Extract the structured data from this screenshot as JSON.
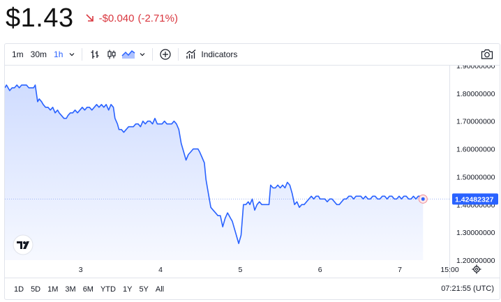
{
  "header": {
    "price": "$1.43",
    "change_amount": "-$0.040",
    "change_percent": "(-2.71%)"
  },
  "colors": {
    "down": "#d9363e",
    "line": "#2962ff",
    "accent": "#2962ff"
  },
  "toolbar": {
    "intervals": [
      "1m",
      "30m",
      "1h"
    ],
    "active_interval": "1h",
    "indicators_label": "Indicators",
    "icons": [
      "chevron-down-icon",
      "bar-chart-icon",
      "candlestick-icon",
      "area-chart-icon",
      "chevron-down-icon",
      "compare-plus-icon",
      "indicators-icon",
      "camera-icon"
    ]
  },
  "ranges": [
    "1D",
    "5D",
    "1M",
    "3M",
    "6M",
    "YTD",
    "1Y",
    "5Y",
    "All"
  ],
  "clock": "07:21:55 (UTC)",
  "chart_data": {
    "type": "area",
    "title": "",
    "xlabel": "",
    "ylabel": "",
    "ylim": [
      1.2,
      1.9
    ],
    "xlim": [
      2.05,
      7.62
    ],
    "y_ticks": [
      "1.20000000",
      "1.30000000",
      "1.40000000",
      "1.50000000",
      "1.60000000",
      "1.70000000",
      "1.80000000",
      "1.90000000"
    ],
    "y_tick_values": [
      1.2,
      1.3,
      1.4,
      1.5,
      1.6,
      1.7,
      1.8,
      1.9
    ],
    "x_ticks": [
      "3",
      "4",
      "5",
      "6",
      "7",
      "15:00"
    ],
    "x_tick_values": [
      3,
      4,
      5,
      6,
      7,
      7.625
    ],
    "last_price_label": "1.42482327",
    "last_price": 1.42482327,
    "grid": false,
    "legend": "none",
    "x": [
      2.05,
      2.07,
      2.09,
      2.11,
      2.14,
      2.17,
      2.2,
      2.23,
      2.26,
      2.29,
      2.32,
      2.35,
      2.38,
      2.41,
      2.43,
      2.46,
      2.48,
      2.51,
      2.53,
      2.56,
      2.59,
      2.62,
      2.65,
      2.68,
      2.71,
      2.73,
      2.76,
      2.79,
      2.82,
      2.84,
      2.87,
      2.9,
      2.93,
      2.96,
      2.99,
      3.02,
      3.05,
      3.08,
      3.11,
      3.14,
      3.17,
      3.2,
      3.23,
      3.26,
      3.29,
      3.32,
      3.35,
      3.38,
      3.41,
      3.43,
      3.46,
      3.48,
      3.51,
      3.54,
      3.57,
      3.6,
      3.63,
      3.66,
      3.69,
      3.72,
      3.75,
      3.78,
      3.81,
      3.84,
      3.87,
      3.9,
      3.93,
      3.96,
      3.99,
      4.02,
      4.05,
      4.08,
      4.11,
      4.14,
      4.17,
      4.2,
      4.23,
      4.26,
      4.29,
      4.32,
      4.35,
      4.38,
      4.41,
      4.44,
      4.47,
      4.49,
      4.52,
      4.55,
      4.57,
      4.6,
      4.63,
      4.66,
      4.69,
      4.72,
      4.75,
      4.78,
      4.81,
      4.84,
      4.86,
      4.88,
      4.9,
      4.92,
      4.94,
      4.96,
      4.98,
      5.01,
      5.04,
      5.07,
      5.1,
      5.12,
      5.15,
      5.18,
      5.21,
      5.24,
      5.27,
      5.3,
      5.33,
      5.36,
      5.38,
      5.41,
      5.44,
      5.47,
      5.5,
      5.53,
      5.56,
      5.59,
      5.62,
      5.65,
      5.68,
      5.71,
      5.74,
      5.77,
      5.8,
      5.83,
      5.86,
      5.89,
      5.92,
      5.95,
      5.98,
      6.0,
      6.03,
      6.06,
      6.09,
      6.12,
      6.15,
      6.18,
      6.21,
      6.24,
      6.27,
      6.3,
      6.33,
      6.36,
      6.39,
      6.42,
      6.45,
      6.48,
      6.51,
      6.54,
      6.57,
      6.6,
      6.63,
      6.66,
      6.69,
      6.72,
      6.75,
      6.78,
      6.81,
      6.84,
      6.87,
      6.9,
      6.93,
      6.96,
      6.99,
      7.02,
      7.05,
      7.08,
      7.11,
      7.14,
      7.17,
      7.2,
      7.23,
      7.26,
      7.29,
      7.29
    ],
    "values": [
      1.82,
      1.83,
      1.82,
      1.81,
      1.82,
      1.82,
      1.83,
      1.82,
      1.83,
      1.83,
      1.83,
      1.82,
      1.82,
      1.82,
      1.83,
      1.77,
      1.78,
      1.77,
      1.76,
      1.75,
      1.75,
      1.74,
      1.75,
      1.73,
      1.74,
      1.73,
      1.72,
      1.71,
      1.71,
      1.72,
      1.73,
      1.73,
      1.74,
      1.73,
      1.74,
      1.75,
      1.74,
      1.75,
      1.75,
      1.74,
      1.75,
      1.76,
      1.75,
      1.76,
      1.75,
      1.76,
      1.74,
      1.76,
      1.75,
      1.71,
      1.69,
      1.67,
      1.67,
      1.66,
      1.67,
      1.68,
      1.68,
      1.68,
      1.69,
      1.69,
      1.68,
      1.7,
      1.69,
      1.7,
      1.7,
      1.69,
      1.71,
      1.69,
      1.69,
      1.69,
      1.7,
      1.69,
      1.69,
      1.69,
      1.7,
      1.69,
      1.67,
      1.62,
      1.59,
      1.56,
      1.58,
      1.59,
      1.6,
      1.6,
      1.6,
      1.59,
      1.57,
      1.55,
      1.49,
      1.44,
      1.39,
      1.38,
      1.37,
      1.36,
      1.36,
      1.32,
      1.35,
      1.37,
      1.36,
      1.35,
      1.34,
      1.32,
      1.3,
      1.28,
      1.26,
      1.29,
      1.4,
      1.4,
      1.41,
      1.4,
      1.42,
      1.38,
      1.4,
      1.41,
      1.4,
      1.4,
      1.4,
      1.4,
      1.47,
      1.46,
      1.46,
      1.47,
      1.46,
      1.47,
      1.46,
      1.48,
      1.47,
      1.44,
      1.4,
      1.41,
      1.39,
      1.4,
      1.4,
      1.41,
      1.42,
      1.43,
      1.42,
      1.43,
      1.43,
      1.42,
      1.42,
      1.42,
      1.41,
      1.42,
      1.42,
      1.41,
      1.4,
      1.4,
      1.41,
      1.42,
      1.42,
      1.43,
      1.43,
      1.42,
      1.43,
      1.43,
      1.43,
      1.42,
      1.43,
      1.42,
      1.42,
      1.43,
      1.43,
      1.42,
      1.42,
      1.43,
      1.43,
      1.42,
      1.43,
      1.43,
      1.42,
      1.42,
      1.43,
      1.42,
      1.43,
      1.43,
      1.42,
      1.42,
      1.43,
      1.42,
      1.43,
      1.43,
      1.42,
      1.42,
      1.42482327
    ]
  }
}
